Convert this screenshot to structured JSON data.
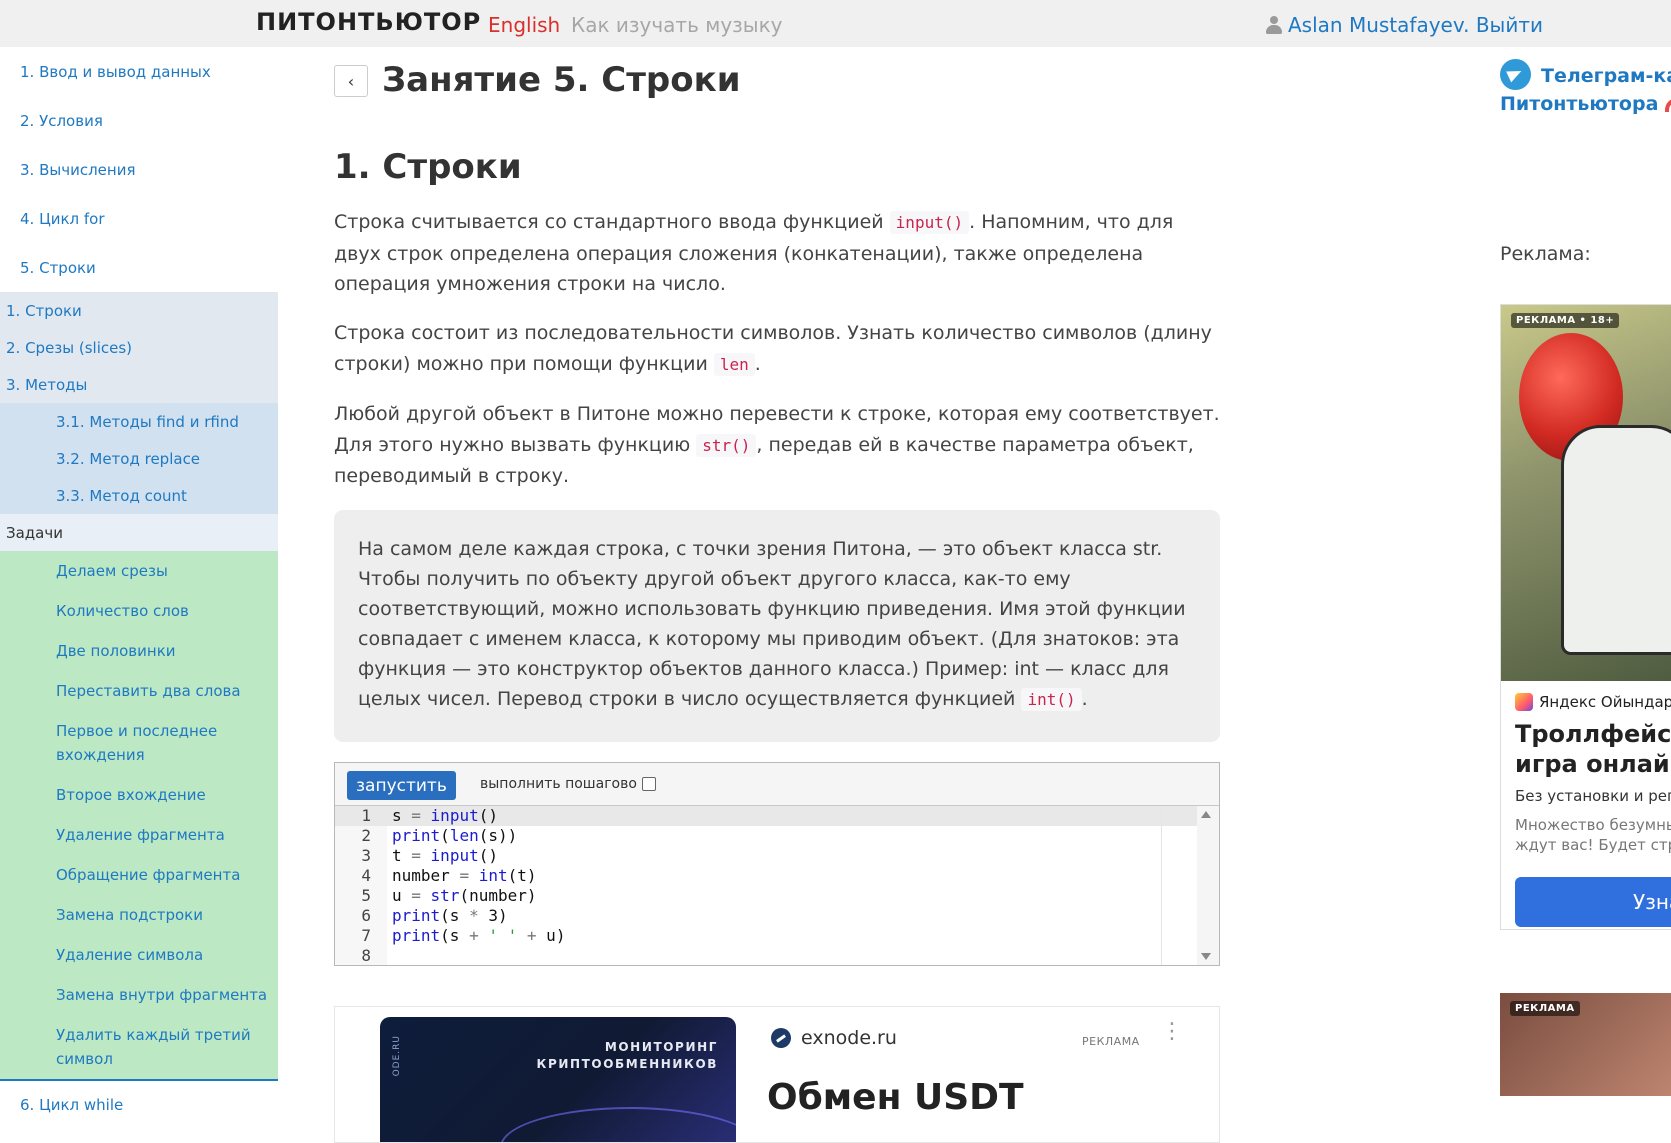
{
  "navbar": {
    "brand": "ПИТОНТЬЮТОР",
    "lang_link": "English",
    "music_link": "Как изучать музыку",
    "user_link": "Aslan Mustafayev. Выйти"
  },
  "sidebar": {
    "top_items": [
      {
        "label": "1. Ввод и вывод данных"
      },
      {
        "label": "2. Условия"
      },
      {
        "label": "3. Вычисления"
      },
      {
        "label": "4. Цикл for"
      },
      {
        "label": "5. Строки"
      }
    ],
    "sub_items": [
      {
        "label": "1. Строки"
      },
      {
        "label": "2. Срезы (slices)"
      },
      {
        "label": "3. Методы"
      }
    ],
    "method_items": [
      {
        "label": "3.1. Методы find и rfind"
      },
      {
        "label": "3.2. Метод replace"
      },
      {
        "label": "3.3. Метод count"
      }
    ],
    "tasks_header": "Задачи",
    "tasks": [
      {
        "label": "Делаем срезы"
      },
      {
        "label": "Количество слов"
      },
      {
        "label": "Две половинки"
      },
      {
        "label": "Переставить два слова"
      },
      {
        "label": "Первое и последнее вхождения"
      },
      {
        "label": "Второе вхождение"
      },
      {
        "label": "Удаление фрагмента"
      },
      {
        "label": "Обращение фрагмента"
      },
      {
        "label": "Замена подстроки"
      },
      {
        "label": "Удаление символа"
      },
      {
        "label": "Замена внутри фрагмента"
      },
      {
        "label": "Удалить каждый третий символ"
      }
    ],
    "after_item": "6. Цикл while"
  },
  "main": {
    "back_icon": "chevron-left-icon",
    "lesson_title": "Занятие 5. Строки",
    "section_title": "1. Строки",
    "para1": {
      "pre": "Строка считывается со стандартного ввода функцией ",
      "code": "input()",
      "post": ". Напомним, что для двух строк определена операция сложения (конкатенации), также определена операция умножения строки на число."
    },
    "para2": {
      "pre": "Строка состоит из последовательности символов. Узнать количество символов (длину строки) можно при помощи функции ",
      "code": "len",
      "post": "."
    },
    "para3": {
      "pre": "Любой другой объект в Питоне можно перевести к строке, которая ему соответствует. Для этого нужно вызвать функцию ",
      "code": "str()",
      "post": ", передав ей в качестве параметра объект, переводимый в строку."
    },
    "note": {
      "pre": "На самом деле каждая строка, с точки зрения Питона, — это объект класса str. Чтобы получить по объекту другой объект другого класса, как-то ему соответствующий, можно использовать функцию приведения. Имя этой функции совпадает с именем класса, к которому мы приводим объект. (Для знатоков: эта функция — это конструктор объектов данного класса.) Пример: int — класс для целых чисел. Перевод строки в число осуществляется функцией ",
      "code": "int()",
      "post": "."
    },
    "runner": {
      "run_label": "запустить",
      "step_label": "выполнить пошагово",
      "step_checked": false,
      "lines": [
        "1",
        "2",
        "3",
        "4",
        "5",
        "6",
        "7",
        "8"
      ]
    }
  },
  "ad_bottom": {
    "image_text_line1": "МОНИТОРИНГ",
    "image_text_line2": "КРИПТООБМЕННИКОВ",
    "image_side_text": "ODE.RU",
    "domain": "exnode.ru",
    "label": "РЕКЛАМА",
    "headline": "Обмен USDT"
  },
  "right": {
    "telegram_line1": "Телеграм-канал",
    "telegram_line2": "Питонтьютора",
    "ad_caption": "Реклама:",
    "ad2": {
      "tag": "РЕКЛАМА • 18+",
      "source": "Яндекс Ойындары",
      "title_line1": "Троллфейс квест",
      "title_line2": "игра онлайн бесплатно",
      "subtitle": "Без установки и регистрации",
      "desc_line1": "Множество безумных уровней",
      "desc_line2": "ждут вас! Будет странно!",
      "button": "Узнать"
    },
    "ad3_tag": "РЕКЛАМА"
  }
}
